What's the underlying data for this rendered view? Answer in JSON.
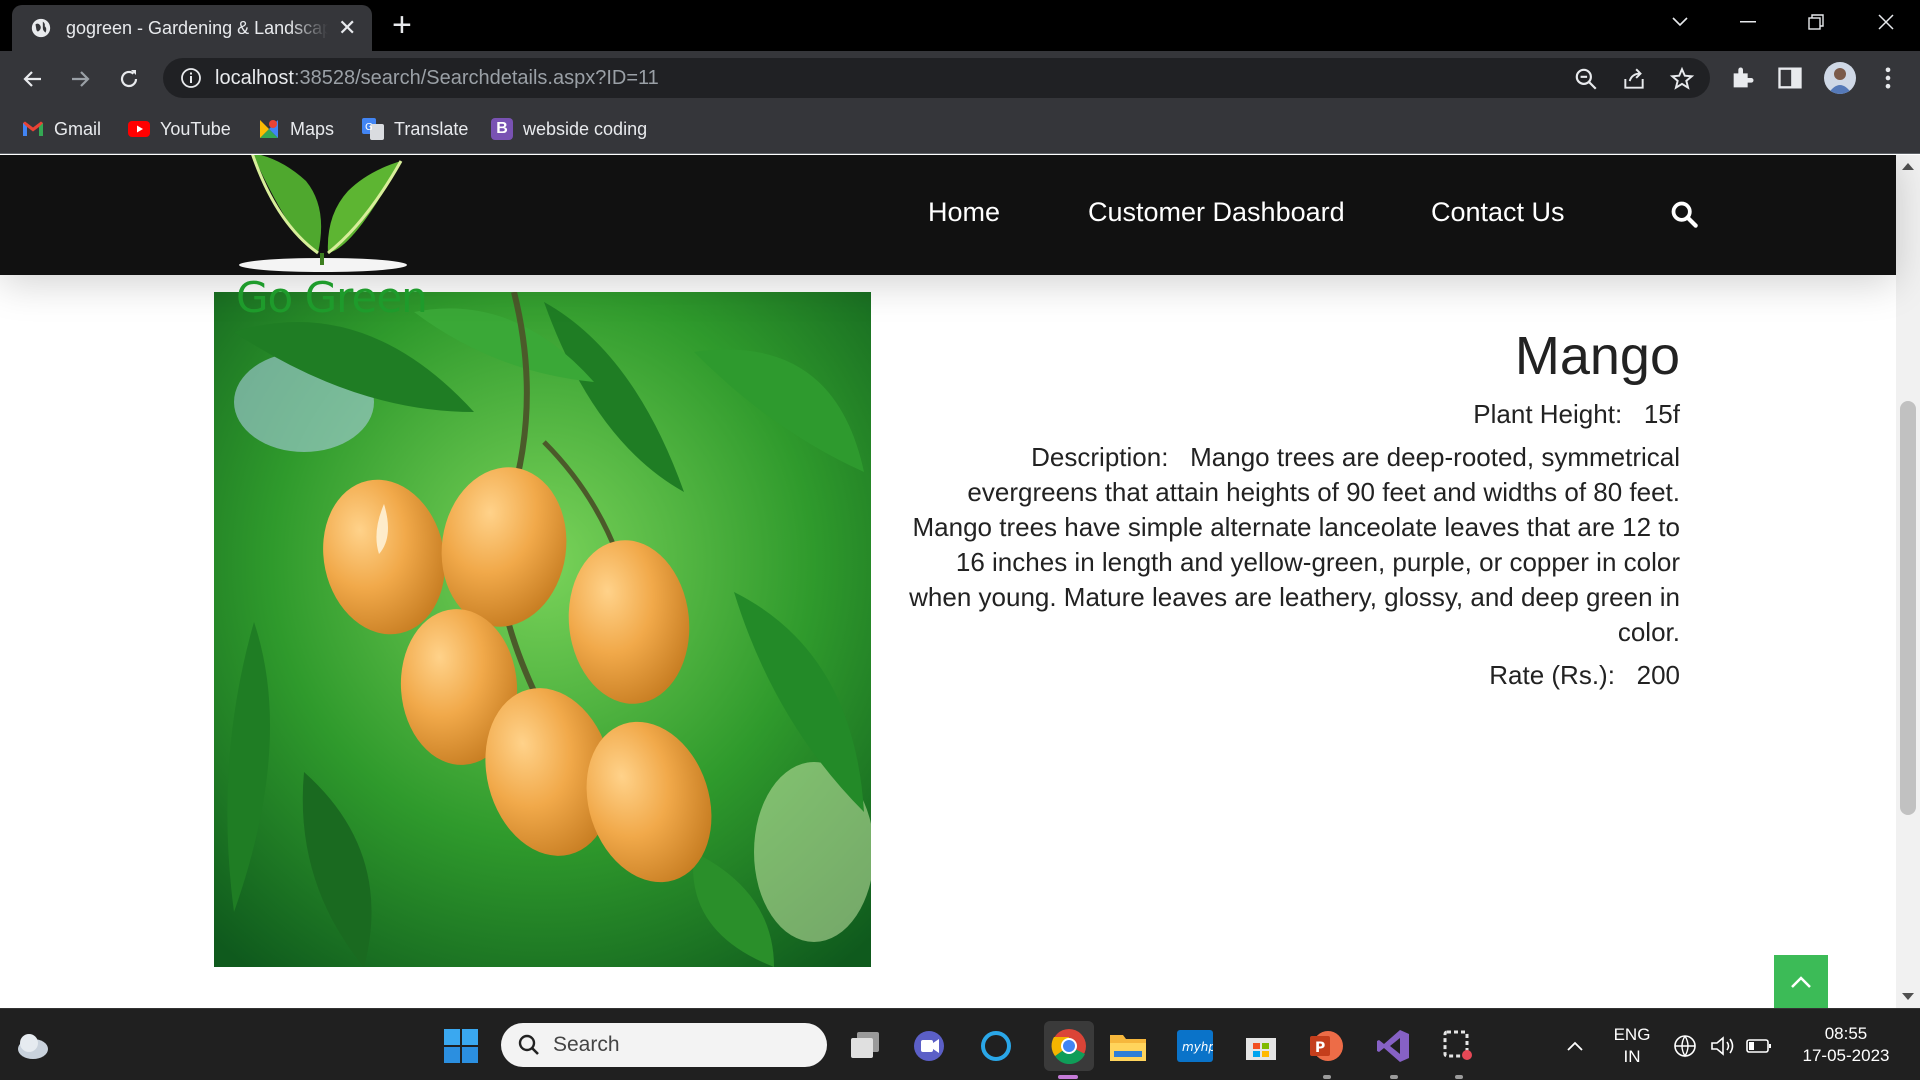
{
  "browser": {
    "tab_title": "gogreen - Gardening & Landscaping",
    "tab_close": "✕",
    "new_tab": "+",
    "url_host": "localhost",
    "url_rest": ":38528/search/Searchdetails.aspx?ID=11",
    "bookmarks": [
      {
        "label": "Gmail",
        "icon": "gmail-icon"
      },
      {
        "label": "YouTube",
        "icon": "youtube-icon"
      },
      {
        "label": "Maps",
        "icon": "maps-icon"
      },
      {
        "label": "Translate",
        "icon": "translate-icon"
      },
      {
        "label": "webside coding",
        "icon": "bootstrap-icon",
        "icon_letter": "B"
      }
    ]
  },
  "site": {
    "logo_text": "Go Green",
    "nav": [
      "Home",
      "Customer Dashboard",
      "Contact Us"
    ]
  },
  "plant": {
    "name": "Mango",
    "height_label": "Plant Height:",
    "height_value": "15f",
    "description_label": "Description:",
    "description": "Mango trees are deep-rooted, symmetrical evergreens that attain heights of 90 feet and widths of 80 feet. Mango trees have simple alternate lanceolate leaves that are 12 to 16 inches in length and yellow-green, purple, or copper in color when young. Mature leaves are leathery, glossy, and deep green in color.",
    "rate_label": "Rate (Rs.):",
    "rate_value": "200"
  },
  "taskbar": {
    "search_label": "Search",
    "lang_top": "ENG",
    "lang_bottom": "IN",
    "time": "08:55",
    "date": "17-05-2023"
  },
  "colors": {
    "accent_green": "#3cbb57",
    "logo_green": "#1e9b2b",
    "header_bg": "#111111"
  }
}
